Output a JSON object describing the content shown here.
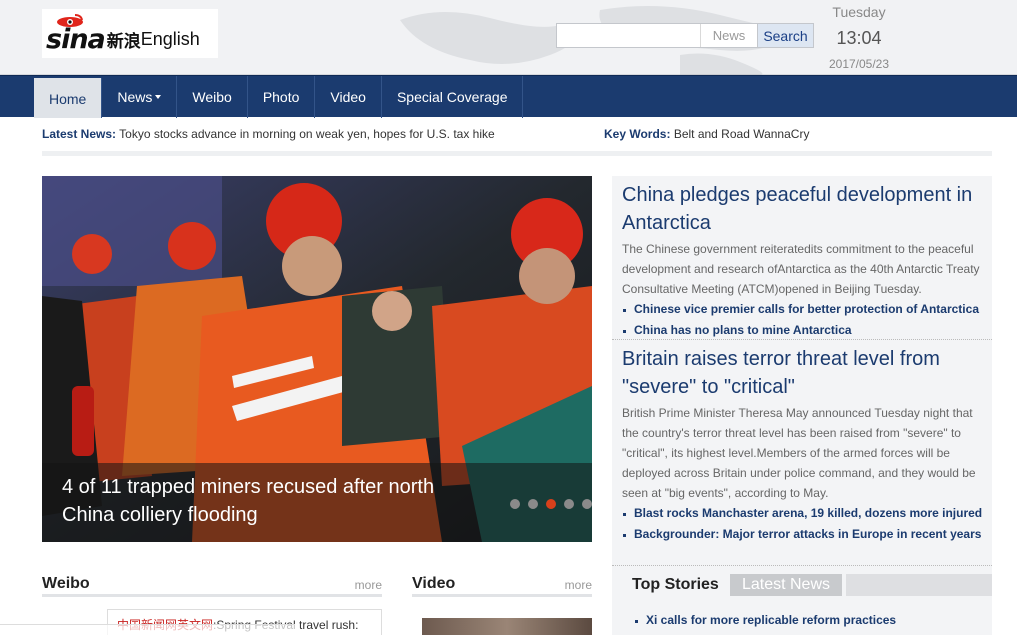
{
  "header": {
    "logo": {
      "sina": "sina",
      "cn": "新浪",
      "en": "English"
    },
    "search": {
      "placeholder": "",
      "category": "News",
      "button": "Search"
    },
    "clock": {
      "day": "Tuesday",
      "time": "13:04",
      "date": "2017/05/23"
    }
  },
  "nav": {
    "items": [
      {
        "label": "Home",
        "active": true
      },
      {
        "label": "News",
        "dropdown": true
      },
      {
        "label": "Weibo"
      },
      {
        "label": "Photo"
      },
      {
        "label": "Video"
      },
      {
        "label": "Special Coverage"
      }
    ]
  },
  "latest": {
    "label": "Latest News:",
    "text": "Tokyo stocks advance in morning on weak yen, hopes for U.S. tax hike",
    "keywords_label": "Key Words:",
    "keywords": "Belt and Road WannaCry"
  },
  "hero": {
    "caption": "4 of 11 trapped miners recused after north China colliery flooding",
    "slides": 5,
    "active_slide": 3
  },
  "stories": [
    {
      "title": "China pledges peaceful development in Antarctica",
      "summary": "The Chinese government reiteratedits commitment to the peaceful development and research ofAntarctica as the 40th Antarctic Treaty Consultative Meeting (ATCM)opened in Beijing Tuesday.",
      "links": [
        "Chinese vice premier calls for better protection of Antarctica",
        "China has no plans to mine Antarctica"
      ]
    },
    {
      "title": "Britain raises terror threat level from \"severe\" to \"critical\"",
      "summary": "British Prime Minister Theresa May announced Tuesday night that the country's terror threat level has been raised from \"severe\" to \"critical\", its highest level.Members of the armed forces will be deployed across Britain under police command, and they would be seen at \"big events\", according to May.",
      "links": [
        "Blast rocks Manchaster arena, 19 killed, dozens more injured",
        "Backgrounder: Major terror attacks in Europe in recent years"
      ]
    }
  ],
  "tabs": {
    "top": "Top Stories",
    "latest": "Latest News"
  },
  "top_stories": [
    "Xi calls for more replicable reform practices"
  ],
  "weibo": {
    "title": "Weibo",
    "more": "more",
    "source": "中国新闻网英文网",
    "text": ":Spring Festival travel rush:"
  },
  "video": {
    "title": "Video",
    "more": "more"
  },
  "colors": {
    "nav": "#1b3b6f",
    "accent": "#d8401b",
    "link": "#1b3b6f"
  }
}
